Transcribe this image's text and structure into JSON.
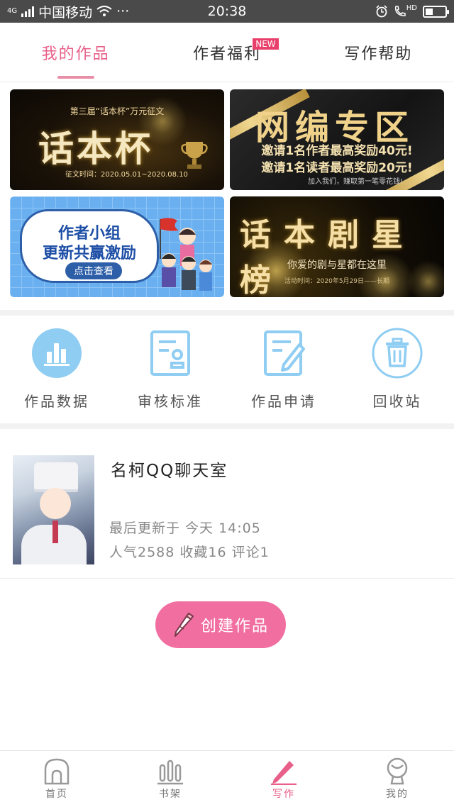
{
  "status_bar": {
    "network": "4G",
    "carrier": "中国移动",
    "dots": "···",
    "time": "20:38",
    "hd": "HD"
  },
  "tabs": [
    {
      "label": "我的作品",
      "active": true
    },
    {
      "label": "作者福利",
      "badge": "NEW"
    },
    {
      "label": "写作帮助"
    }
  ],
  "banners": {
    "b1": {
      "subtitle": "第三届“话本杯”万元征文",
      "title": "话本杯",
      "date": "征文时间：2020.05.01~2020.08.10"
    },
    "b2": {
      "title": "网编专区",
      "line1": "邀请1名作者最高奖励40元!",
      "line2": "邀请1名读者最高奖励20元!",
      "footer": "加入我们，赚取第一笔零花钱!"
    },
    "b3": {
      "line1": "作者小组",
      "line2": "更新共赢激励",
      "button": "点击查看"
    },
    "b4": {
      "title": "话本剧星榜",
      "line": "你爱的剧与星都在这里",
      "footer": "活动时间：2020年5月29日——长期"
    }
  },
  "shortcuts": [
    {
      "label": "作品数据",
      "icon": "bar-chart-icon"
    },
    {
      "label": "审核标准",
      "icon": "document-stamp-icon"
    },
    {
      "label": "作品申请",
      "icon": "document-pen-icon"
    },
    {
      "label": "回收站",
      "icon": "trash-icon"
    }
  ],
  "work": {
    "title": "名柯QQ聊天室",
    "updated": "最后更新于 今天 14:05",
    "stats": "人气2588 收藏16 评论1"
  },
  "create_button": "创建作品",
  "bottom_nav": [
    {
      "label": "首页",
      "icon": "home-icon"
    },
    {
      "label": "书架",
      "icon": "bookshelf-icon"
    },
    {
      "label": "写作",
      "icon": "pen-icon",
      "active": true
    },
    {
      "label": "我的",
      "icon": "profile-icon"
    }
  ],
  "colors": {
    "accent": "#e8608a",
    "icon_blue": "#8fcdf2",
    "create_button": "#f06ea0"
  }
}
